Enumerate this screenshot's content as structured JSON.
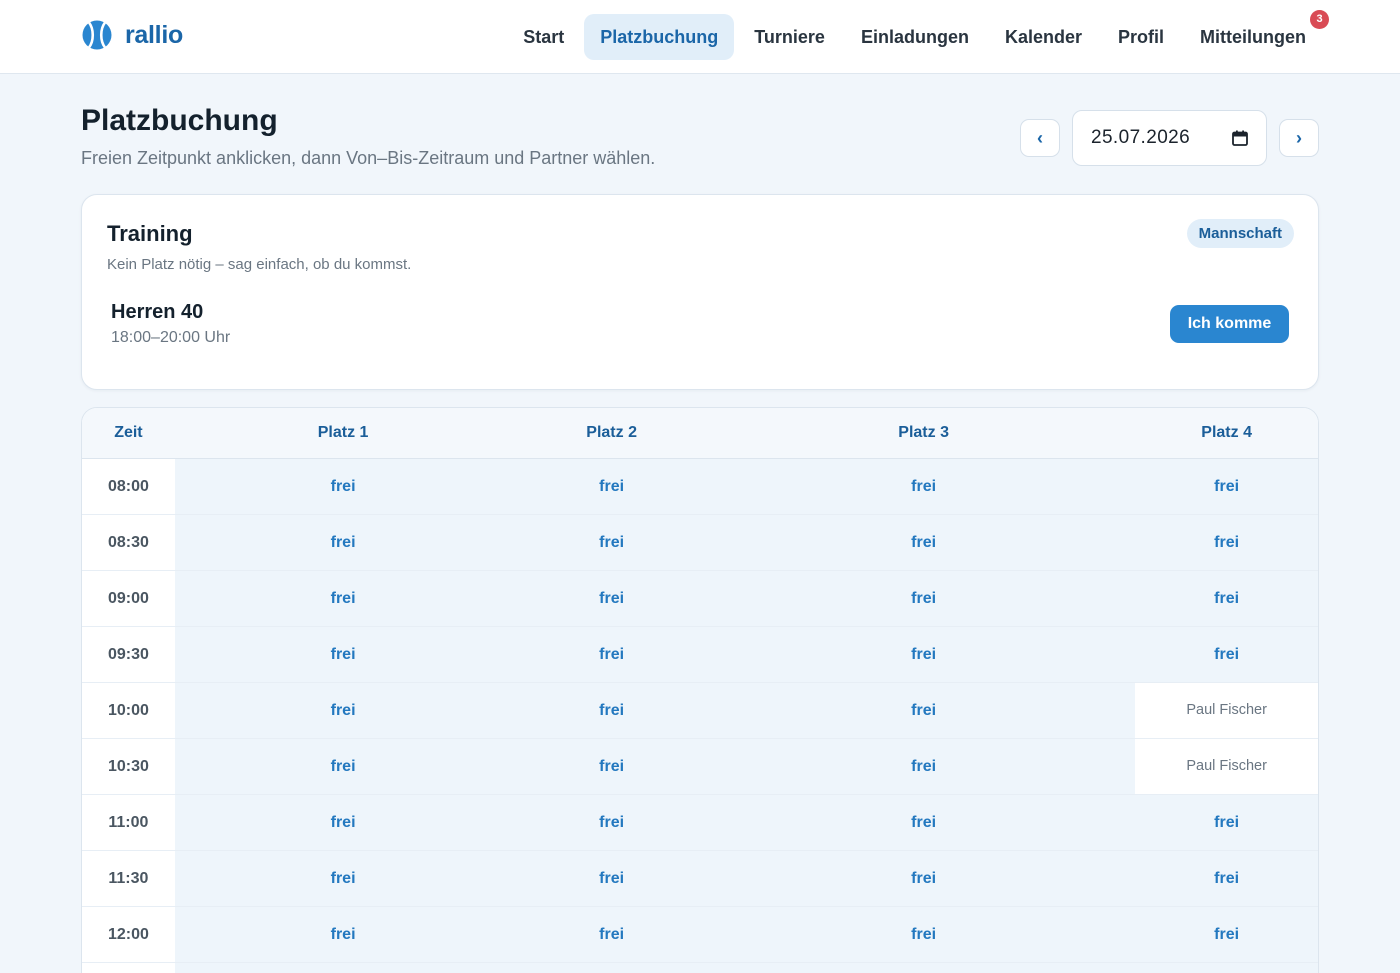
{
  "brand": {
    "name": "rallio"
  },
  "nav": [
    {
      "label": "Start",
      "active": false
    },
    {
      "label": "Platzbuchung",
      "active": true
    },
    {
      "label": "Turniere",
      "active": false
    },
    {
      "label": "Einladungen",
      "active": false
    },
    {
      "label": "Kalender",
      "active": false
    },
    {
      "label": "Profil",
      "active": false
    },
    {
      "label": "Mitteilungen",
      "active": false,
      "badge": "3"
    }
  ],
  "page": {
    "title": "Platzbuchung",
    "subtitle": "Freien Zeitpunkt anklicken, dann Von–Bis-Zeitraum und Partner wählen."
  },
  "date": {
    "prev": "‹",
    "value": "25.07.2026",
    "next": "›"
  },
  "training": {
    "title": "Training",
    "subtitle": "Kein Platz nötig – sag einfach, ob du kommst.",
    "badge": "Mannschaft",
    "team": "Herren 40",
    "time": "18:00–20:00 Uhr",
    "button": "Ich komme"
  },
  "schedule": {
    "headers": [
      "Zeit",
      "Platz 1",
      "Platz 2",
      "Platz 3",
      "Platz 4"
    ],
    "rows": [
      {
        "time": "08:00",
        "cells": [
          "frei",
          "frei",
          "frei",
          "frei"
        ]
      },
      {
        "time": "08:30",
        "cells": [
          "frei",
          "frei",
          "frei",
          "frei"
        ]
      },
      {
        "time": "09:00",
        "cells": [
          "frei",
          "frei",
          "frei",
          "frei"
        ]
      },
      {
        "time": "09:30",
        "cells": [
          "frei",
          "frei",
          "frei",
          "frei"
        ]
      },
      {
        "time": "10:00",
        "cells": [
          "frei",
          "frei",
          "frei",
          "Paul Fischer"
        ]
      },
      {
        "time": "10:30",
        "cells": [
          "frei",
          "frei",
          "frei",
          "Paul Fischer"
        ]
      },
      {
        "time": "11:00",
        "cells": [
          "frei",
          "frei",
          "frei",
          "frei"
        ]
      },
      {
        "time": "11:30",
        "cells": [
          "frei",
          "frei",
          "frei",
          "frei"
        ]
      },
      {
        "time": "12:00",
        "cells": [
          "frei",
          "frei",
          "frei",
          "frei"
        ]
      }
    ]
  },
  "colors": {
    "accent": "#1b66a8",
    "button": "#2a86d0",
    "free_cell": "#eef5fb",
    "badge": "#d94b55"
  },
  "icons": {
    "brand": "tennis-ball-icon",
    "date": "calendar-icon",
    "prev": "chevron-left-icon",
    "next": "chevron-right-icon"
  }
}
